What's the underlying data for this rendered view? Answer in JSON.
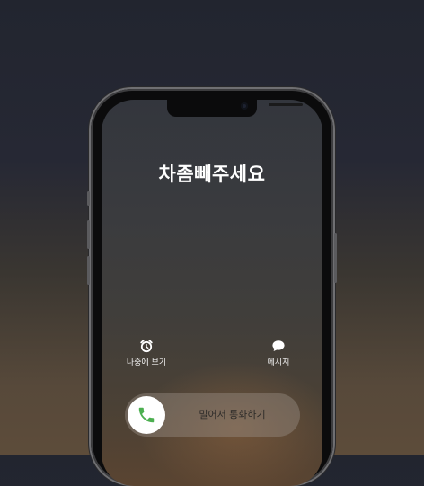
{
  "call": {
    "caller_name": "차좀빼주세요"
  },
  "actions": {
    "remind": {
      "label": "나중에 보기",
      "icon": "alarm-clock-icon"
    },
    "message": {
      "label": "메시지",
      "icon": "chat-bubble-icon"
    }
  },
  "slider": {
    "label": "밀어서 통화하기",
    "knob_icon": "phone-icon",
    "knob_color": "#4caf50"
  },
  "colors": {
    "accept": "#4caf50",
    "text": "#ffffff"
  }
}
